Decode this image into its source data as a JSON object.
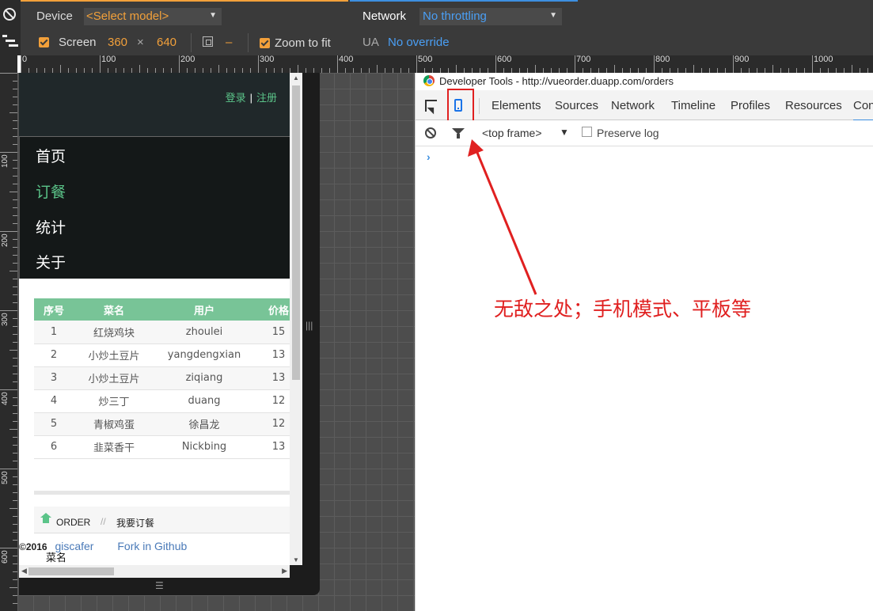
{
  "emulation": {
    "device_label": "Device",
    "model_select": "<Select model>",
    "screen_label": "Screen",
    "screen_width": "360",
    "times": "×",
    "screen_height": "640",
    "dash": "–",
    "zoom_label": "Zoom to fit",
    "network_label": "Network",
    "network_select": "No throttling",
    "ua_label": "UA",
    "ua_value": "No override"
  },
  "ruler": {
    "top": [
      "0",
      "100",
      "200",
      "300",
      "400",
      "500",
      "600",
      "700",
      "800",
      "900",
      "1000"
    ],
    "left": [
      "100",
      "200",
      "300",
      "400",
      "500",
      "600"
    ]
  },
  "app": {
    "login": "登录",
    "separator": "|",
    "register": "注册",
    "menu": [
      {
        "label": "首页"
      },
      {
        "label": "订餐"
      },
      {
        "label": "统计"
      },
      {
        "label": "关于"
      }
    ],
    "table": {
      "headers": [
        "序号",
        "菜名",
        "用户",
        "价格"
      ],
      "rows": [
        [
          "1",
          "红烧鸡块",
          "zhoulei",
          "15"
        ],
        [
          "2",
          "小炒土豆片",
          "yangdengxian",
          "13"
        ],
        [
          "3",
          "小炒土豆片",
          "ziqiang",
          "13"
        ],
        [
          "4",
          "炒三丁",
          "duang",
          "12"
        ],
        [
          "5",
          "青椒鸡蛋",
          "徐昌龙",
          "12"
        ],
        [
          "6",
          "韭菜香干",
          "Nickbing",
          "13"
        ]
      ]
    },
    "breadcrumb": {
      "home": "ORDER",
      "sep": "//",
      "current": "我要订餐"
    },
    "footer": {
      "copyright": "©2016",
      "author": "giscafer",
      "fork": "Fork in Github"
    },
    "cut_label": "菜名"
  },
  "devtools": {
    "title": "Developer Tools - http://vueorder.duapp.com/orders",
    "tabs": [
      "Elements",
      "Sources",
      "Network",
      "Timeline",
      "Profiles",
      "Resources",
      "Con"
    ],
    "frame": "<top frame>",
    "frame_arrow": "▼",
    "preserve_log": "Preserve log",
    "prompt": "›"
  },
  "annotation": {
    "text": "无敌之处；手机模式、平板等",
    "color": "#e02020"
  },
  "colors": {
    "accent_orange": "#f2a03a",
    "accent_blue": "#3d8fe0",
    "menu_green": "#5bc489"
  },
  "scrollbars": {
    "page_vertical_thumb": "0.63",
    "page_horizontal_thumb": "0.34"
  }
}
